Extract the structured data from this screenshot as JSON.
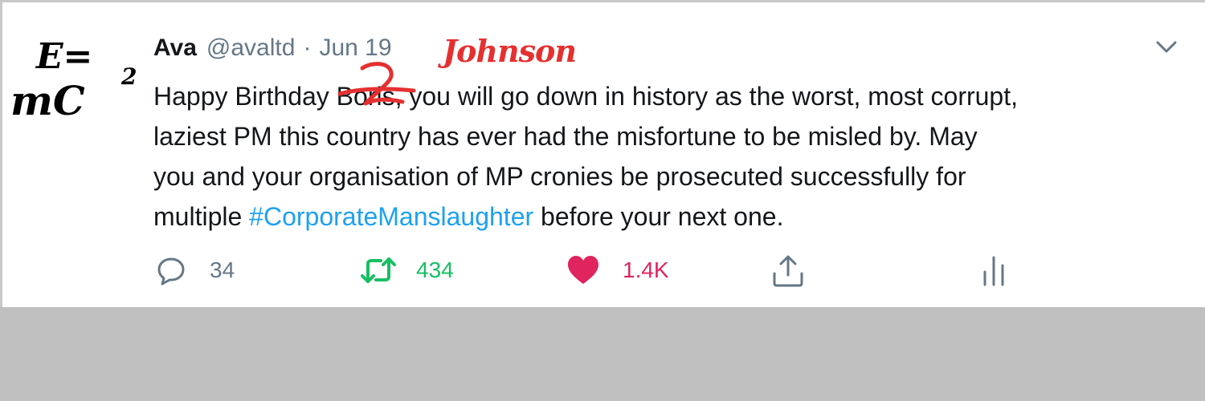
{
  "avatar_text": {
    "line1": "E=",
    "line2": "mC",
    "exponent": "2"
  },
  "tweet": {
    "name": "Ava",
    "handle": "@avaltd",
    "separator": "·",
    "date": "Jun 19",
    "correction": "Johnson",
    "text_line1_pre": "Happy Birthday ",
    "text_struck": "Boris",
    "text_line1_post": ", you will go down in history as the worst, most corrupt,",
    "text_line2": "laziest PM this country has ever had the misfortune to be misled by.  May",
    "text_line3": "you and your organisation of MP cronies be prosecuted successfully for",
    "text_line4_pre": "multiple ",
    "hashtag": "#CorporateManslaughter",
    "text_line4_post": " before your next one."
  },
  "actions": {
    "reply_count": "34",
    "retweet_count": "434",
    "like_count": "1.4K"
  },
  "icons": {
    "reply": "reply-icon",
    "retweet": "retweet-icon",
    "like": "heart-icon",
    "share": "share-icon",
    "analytics": "analytics-icon",
    "caret": "chevron-down-icon"
  },
  "colors": {
    "text": "#14171a",
    "muted": "#657786",
    "link": "#1da1f2",
    "retweet": "#17bf63",
    "like": "#e0245e",
    "annotation": "#e53030",
    "background_below": "#c0c0c0"
  }
}
